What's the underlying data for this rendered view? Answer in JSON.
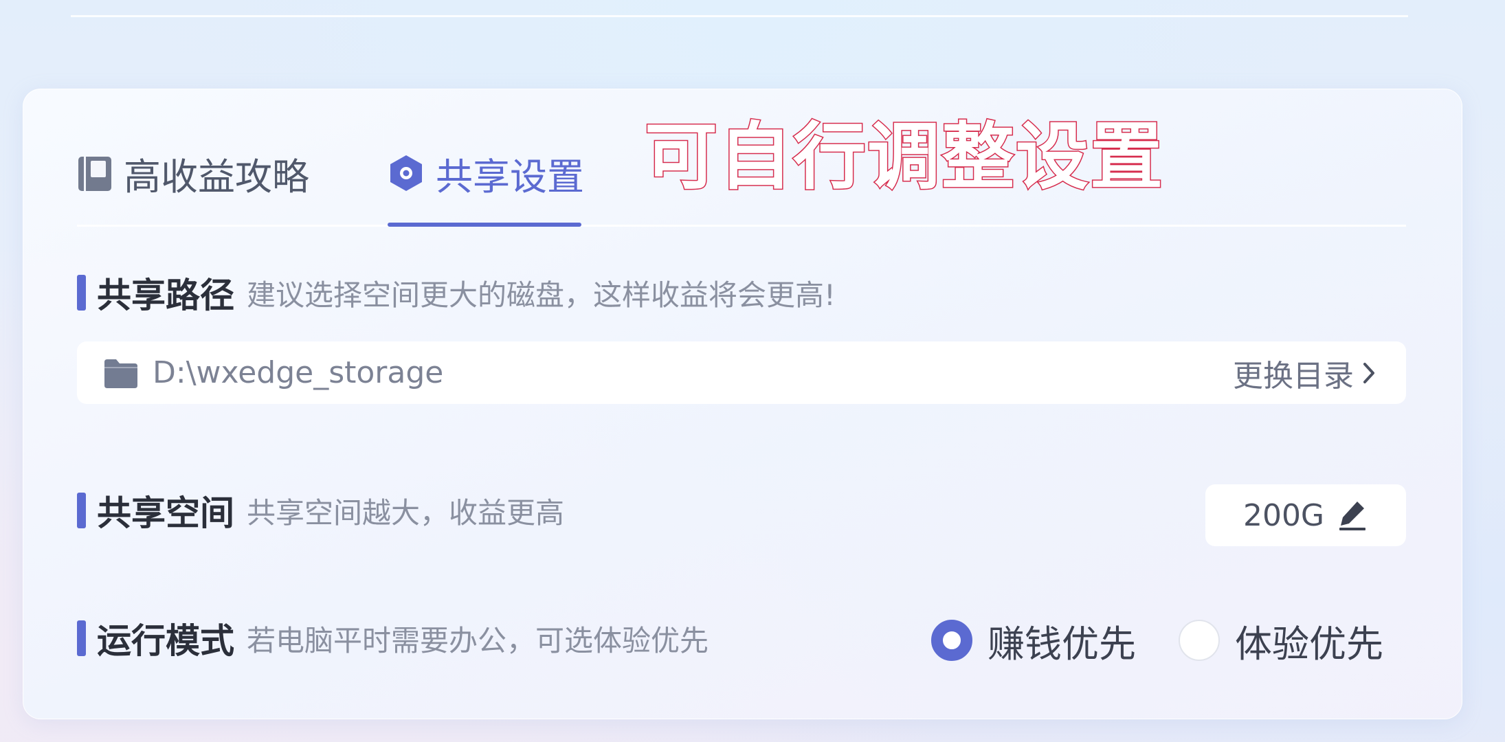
{
  "overlay_caption": "可自行调整设置",
  "tabs": [
    {
      "label": "高收益攻略",
      "icon": "book-icon",
      "active": false
    },
    {
      "label": "共享设置",
      "icon": "hexagon-settings-icon",
      "active": true
    }
  ],
  "share_path": {
    "title": "共享路径",
    "hint": "建议选择空间更大的磁盘，这样收益将会更高!",
    "path_value": "D:\\wxedge_storage",
    "change_label": "更换目录"
  },
  "share_space": {
    "title": "共享空间",
    "hint": "共享空间越大，收益更高",
    "value": "200G"
  },
  "run_mode": {
    "title": "运行模式",
    "hint": "若电脑平时需要办公，可选体验优先",
    "options": [
      {
        "label": "赚钱优先",
        "selected": true
      },
      {
        "label": "体验优先",
        "selected": false
      }
    ]
  },
  "colors": {
    "accent": "#5b6ad1",
    "caption_stroke": "#d62c4d"
  }
}
